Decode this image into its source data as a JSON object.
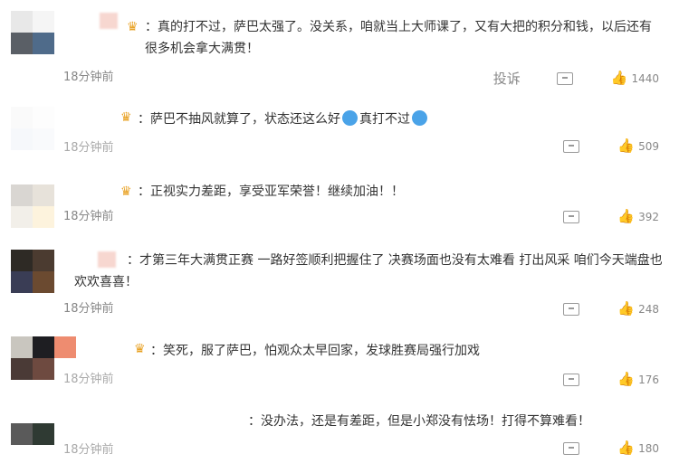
{
  "comments": [
    {
      "name_badge": "♛",
      "text": "：真的打不过，萨巴太强了。没关系，咱就当上大师课了，又有大把的积分和钱，以后还有很多机会拿大满贯！",
      "time": "18分钟前",
      "report": "投诉",
      "likes": "1440",
      "colors": [
        "#e8e8e8",
        "#f5f5f5",
        "#5a5f66",
        "#4f6b8a"
      ]
    },
    {
      "name_badge": "♛",
      "text_a": "萨巴不抽风就算了，状态还这么好",
      "text_b": "真打不过",
      "time": "18分钟前",
      "likes": "509",
      "colors": [
        "#fafafa",
        "#fdfdfd",
        "#f6f8fb",
        "#f9fafc"
      ]
    },
    {
      "name_badge": "♛",
      "text": "：正视实力差距，享受亚军荣誉！继续加油！！",
      "time": "18分钟前",
      "likes": "392",
      "colors": [
        "#d9d6d2",
        "#e7e2da",
        "#f2efe9",
        "#fdf3dd"
      ]
    },
    {
      "text": "：才第三年大满贯正赛 一路好签顺利把握住了 决赛场面也没有太难看 打出风采 咱们今天端盘也欢欢喜喜！",
      "time": "18分钟前",
      "likes": "248",
      "colors": [
        "#2e2a25",
        "#4b3b30",
        "#3a3d55",
        "#6b4a30"
      ]
    },
    {
      "name_badge": "♛",
      "text": "：笑死，服了萨巴，怕观众太早回家，发球胜赛局强行加戏",
      "time": "18分钟前",
      "likes": "176",
      "colors": [
        "#c9c6bf",
        "#1e1e22",
        "#4a3a36",
        "#6e4a40"
      ]
    },
    {
      "text": "：没办法，还是有差距，但是小郑没有怯场！打得不算难看！",
      "time": "18分钟前",
      "likes": "180",
      "colors": [
        "#5a5a5a",
        "#2f3a33",
        "#ffffff",
        "#ffffff"
      ]
    }
  ]
}
